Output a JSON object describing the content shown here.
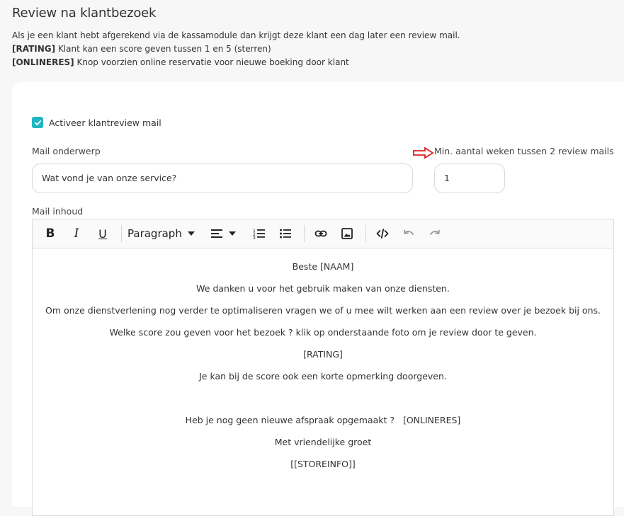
{
  "header": {
    "title": "Review na klantbezoek",
    "description": "Als je een klant hebt afgerekend via de kassamodule dan krijgt deze klant een dag later een review mail.",
    "rating_tag": "[RATING]",
    "rating_text": "Klant kan een score geven tussen 1 en 5 (sterren)",
    "onlineres_tag": "[ONLINERES]",
    "onlineres_text": "Knop voorzien online reservatie voor nieuwe boeking door klant"
  },
  "form": {
    "activate_label": "Activeer klantreview mail",
    "activate_checked": true,
    "subject_label": "Mail onderwerp",
    "subject_value": "Wat vond je van onze service?",
    "min_weeks_label": "Min. aantal weken tussen 2 review mails",
    "min_weeks_value": "1",
    "content_label": "Mail inhoud"
  },
  "toolbar": {
    "paragraph_label": "Paragraph",
    "icons": [
      "bold-icon",
      "italic-icon",
      "underline-icon",
      "align-icon",
      "numbered-list-icon",
      "bullet-list-icon",
      "link-icon",
      "image-icon",
      "code-icon",
      "undo-icon",
      "redo-icon"
    ]
  },
  "editor_content": [
    "Beste [NAAM]",
    "We danken u voor het gebruik maken van onze diensten.",
    "Om onze dienstverlening nog verder te optimaliseren vragen we of u mee wilt werken aan een review over je bezoek bij ons.",
    "Welke score zou geven voor het bezoek ? klik op onderstaande foto om je review door te geven.",
    "[RATING]",
    "Je kan bij de score ook een korte opmerking doorgeven.",
    "",
    "Heb je nog geen nieuwe afspraak opgemaakt ?   [ONLINERES]",
    "Met vriendelijke groet",
    "[[STOREINFO]]"
  ],
  "colors": {
    "accent": "#1fb5c2",
    "arrow": "#e02020"
  }
}
